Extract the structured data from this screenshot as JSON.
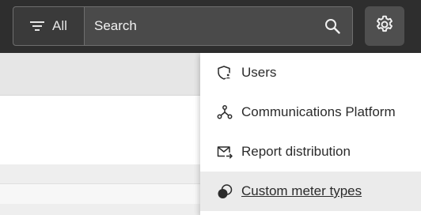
{
  "topbar": {
    "filter": {
      "label": "All",
      "icon": "filter-icon"
    },
    "search": {
      "placeholder": "Search",
      "icon": "search-icon"
    },
    "settings": {
      "icon": "gear-icon"
    }
  },
  "menu": {
    "items": [
      {
        "label": "Users",
        "icon": "shield-user-icon"
      },
      {
        "label": "Communications Platform",
        "icon": "network-nodes-icon"
      },
      {
        "label": "Report distribution",
        "icon": "mail-forward-icon"
      },
      {
        "label": "Custom meter types",
        "icon": "meter-circles-icon"
      }
    ]
  },
  "colors": {
    "topbar_bg": "#2e2e2e",
    "menu_hover_bg": "#ebebeb",
    "text": "#2b2b2b"
  }
}
